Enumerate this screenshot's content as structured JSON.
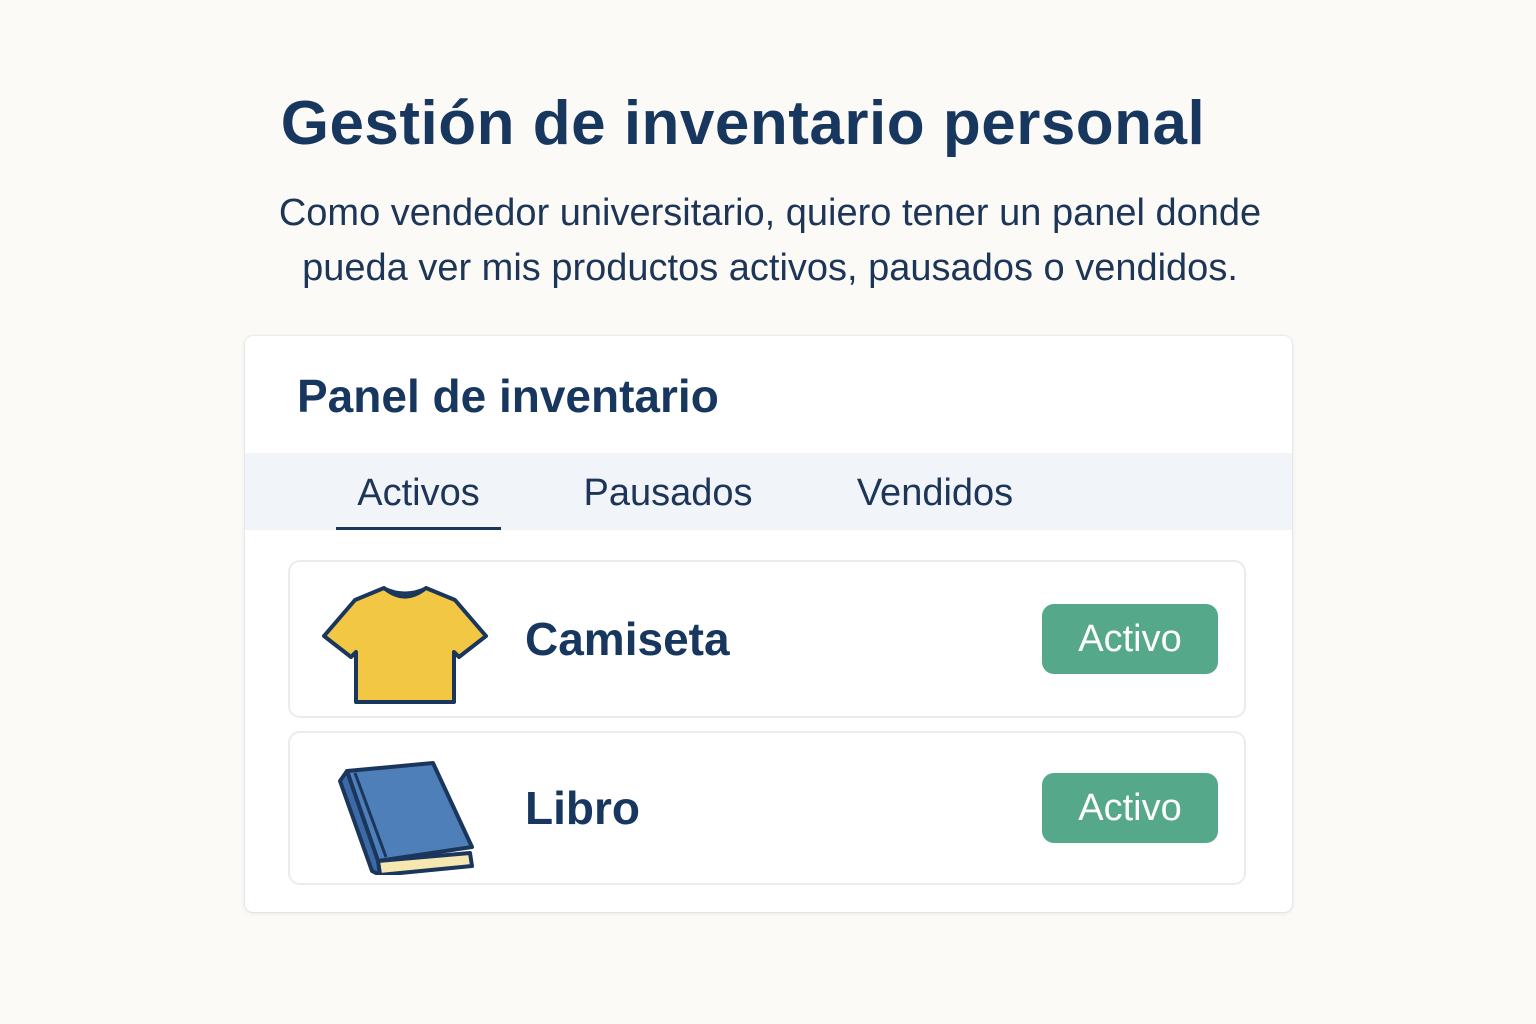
{
  "header": {
    "title": "Gestión de inventario personal",
    "subtitle_line1": "Como vendedor universitario, quiero tener un panel donde",
    "subtitle_line2": "pueda ver mis productos activos, pausados o vendidos."
  },
  "panel": {
    "title": "Panel de inventario",
    "tabs": [
      {
        "label": "Activos",
        "selected": true
      },
      {
        "label": "Pausados",
        "selected": false
      },
      {
        "label": "Vendidos",
        "selected": false
      }
    ],
    "items": [
      {
        "name": "Camiseta",
        "status": "Activo",
        "icon": "tshirt-icon"
      },
      {
        "name": "Libro",
        "status": "Activo",
        "icon": "book-icon"
      }
    ]
  },
  "colors": {
    "text_primary": "#17375e",
    "status_active": "#55a88a",
    "tab_bar_background": "#f1f4f8",
    "tshirt": "#f2c744",
    "book": "#4f7fb8"
  }
}
